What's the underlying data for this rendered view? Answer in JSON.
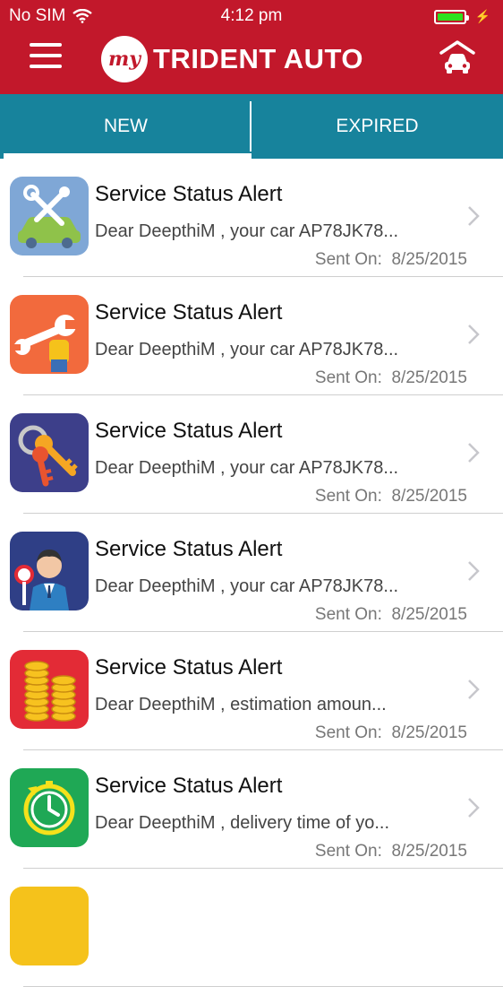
{
  "status_bar": {
    "carrier": "No SIM",
    "time": "4:12 pm",
    "battery_color": "#2ee11f"
  },
  "header": {
    "logo_badge": "my",
    "app_name": "TRIDENT AUTO",
    "menu_icon": "hamburger-menu-icon",
    "garage_icon": "car-garage-icon",
    "brand_color": "#c2182b"
  },
  "tabs": [
    {
      "label": "NEW",
      "active": true
    },
    {
      "label": "EXPIRED",
      "active": false
    }
  ],
  "tab_color": "#17839c",
  "notifications": [
    {
      "icon": "car-repair-tools-icon",
      "icon_bg": "#7fa7d6",
      "title": "Service Status Alert",
      "message": "Dear DeepthiM , your car AP78JK78...",
      "sent_label": "Sent On:",
      "sent_date": "8/25/2015"
    },
    {
      "icon": "wrench-hand-icon",
      "icon_bg": "#f26a3d",
      "title": "Service Status Alert",
      "message": "Dear DeepthiM , your car AP78JK78...",
      "sent_label": "Sent On:",
      "sent_date": "8/25/2015"
    },
    {
      "icon": "car-keys-icon",
      "icon_bg": "#3d3f8a",
      "title": "Service Status Alert",
      "message": "Dear DeepthiM , your car AP78JK78...",
      "sent_label": "Sent On:",
      "sent_date": "8/25/2015"
    },
    {
      "icon": "service-advisor-icon",
      "icon_bg": "#2f3f86",
      "title": "Service Status Alert",
      "message": "Dear DeepthiM , your car AP78JK78...",
      "sent_label": "Sent On:",
      "sent_date": "8/25/2015"
    },
    {
      "icon": "coin-stacks-icon",
      "icon_bg": "#e32b36",
      "title": "Service Status Alert",
      "message": "Dear DeepthiM , estimation amoun...",
      "sent_label": "Sent On:",
      "sent_date": "8/25/2015"
    },
    {
      "icon": "delivery-clock-icon",
      "icon_bg": "#1fa855",
      "title": "Service Status Alert",
      "message": "Dear DeepthiM , delivery time of yo...",
      "sent_label": "Sent On:",
      "sent_date": "8/25/2015"
    },
    {
      "icon": "partial-row-icon",
      "icon_bg": "#f5c21b",
      "title": "",
      "message": "",
      "sent_label": "",
      "sent_date": ""
    }
  ]
}
